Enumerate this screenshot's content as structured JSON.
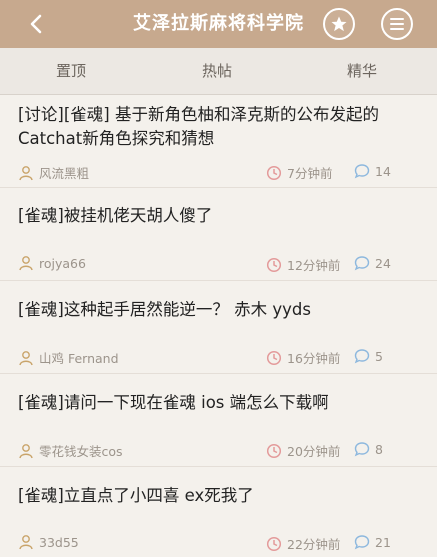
{
  "header": {
    "title": "艾泽拉斯麻将科学院",
    "back_icon": "chevron-left-icon",
    "star_icon": "star-icon",
    "menu_icon": "menu-icon",
    "bg_color": "#c7a98e"
  },
  "tabs": [
    {
      "label": "置顶"
    },
    {
      "label": "热帖"
    },
    {
      "label": "精华"
    }
  ],
  "posts": [
    {
      "title_line1": "[讨论][雀魂] 基于新角色柚和泽克斯的公布发起的",
      "title_line2": "Catchat新角色探究和猜想",
      "author": "风流黑粗",
      "time": "7分钟前",
      "comments": "14"
    },
    {
      "title_line1": "[雀魂]被挂机佬天胡人傻了",
      "title_line2": "",
      "author": "rojya66",
      "time": "12分钟前",
      "comments": "24"
    },
    {
      "title_line1": "[雀魂]这种起手居然能逆一？ 赤木 yyds",
      "title_line2": "",
      "author": "山鸡 Fernand",
      "time": "16分钟前",
      "comments": "5"
    },
    {
      "title_line1": "[雀魂]请问一下现在雀魂 ios 端怎么下载啊",
      "title_line2": "",
      "author": "零花钱女装cos",
      "time": "20分钟前",
      "comments": "8"
    },
    {
      "title_line1": "[雀魂]立直点了小四喜 ex死我了",
      "title_line2": "",
      "author": "33d55",
      "time": "22分钟前",
      "comments": "21"
    }
  ],
  "meta_icons": {
    "author": "user-icon",
    "time": "clock-icon",
    "comments": "comment-icon"
  }
}
